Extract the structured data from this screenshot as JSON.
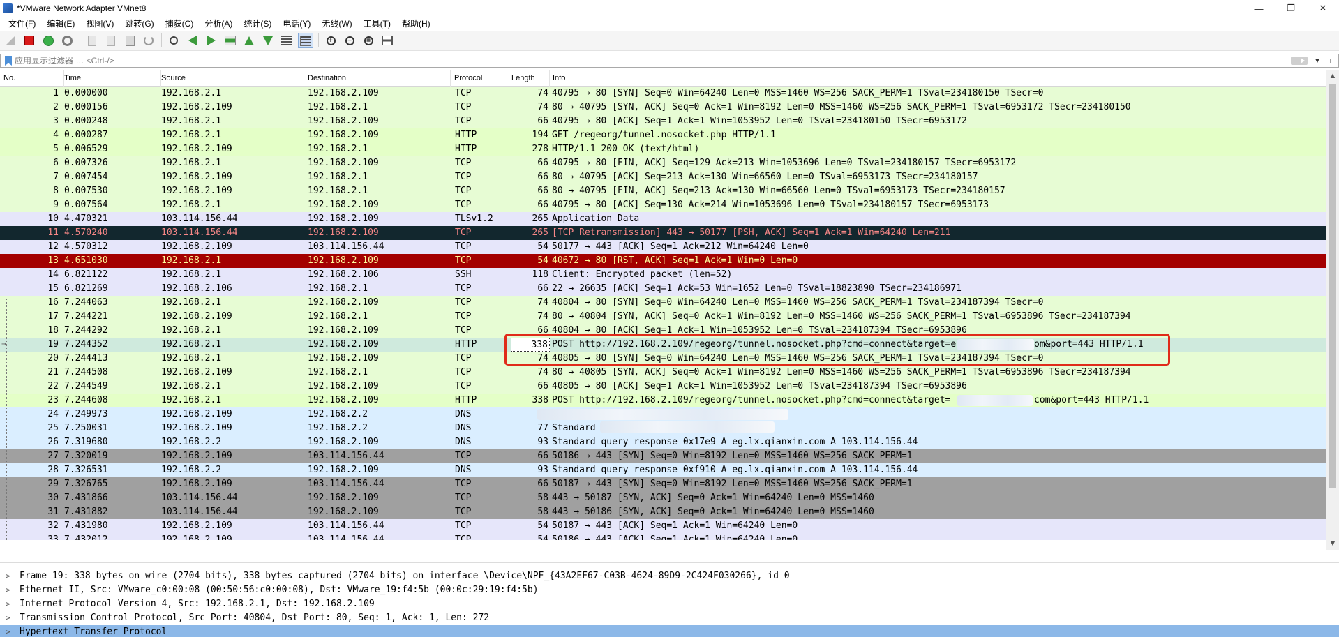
{
  "window": {
    "title": "*VMware Network Adapter VMnet8",
    "controls": [
      "—",
      "❐",
      "✕"
    ]
  },
  "menu": [
    "文件(F)",
    "编辑(E)",
    "视图(V)",
    "跳转(G)",
    "捕获(C)",
    "分析(A)",
    "统计(S)",
    "电话(Y)",
    "无线(W)",
    "工具(T)",
    "帮助(H)"
  ],
  "toolbar": {
    "icons": [
      "shark-fin-icon",
      "stop-capture-icon",
      "restart-capture-icon",
      "capture-options-gear-icon",
      "open-file-icon",
      "save-file-icon",
      "close-file-icon",
      "reload-file-icon",
      "find-packet-icon",
      "go-back-icon",
      "go-forward-icon",
      "go-to-packet-icon",
      "first-packet-icon",
      "last-packet-icon",
      "auto-scroll-icon",
      "colorize-icon",
      "zoom-in-icon",
      "zoom-out-icon",
      "zoom-normal-icon",
      "resize-columns-icon"
    ]
  },
  "filter": {
    "placeholder": "应用显示过滤器 … <Ctrl-/>",
    "value": ""
  },
  "columns": [
    "No.",
    "Time",
    "Source",
    "Destination",
    "Protocol",
    "Length",
    "Info"
  ],
  "row_colors": {
    "tcp": "#e7fcd4",
    "http": "#e4ffc7",
    "tls": "#e6e6fa",
    "ssh": "#e6e6fa",
    "dns": "#daeeff",
    "retrans": "#12272e",
    "rst": "#a40000",
    "syn_gray": "#a0a0a0",
    "selected": "#cfeadd"
  },
  "packets": [
    {
      "no": "1",
      "time": "0.000000",
      "src": "192.168.2.1",
      "dst": "192.168.2.109",
      "proto": "TCP",
      "len": "74",
      "info": "40795 → 80 [SYN] Seq=0 Win=64240 Len=0 MSS=1460 WS=256 SACK_PERM=1 TSval=234180150 TSecr=0",
      "style": "tcp"
    },
    {
      "no": "2",
      "time": "0.000156",
      "src": "192.168.2.109",
      "dst": "192.168.2.1",
      "proto": "TCP",
      "len": "74",
      "info": "80 → 40795 [SYN, ACK] Seq=0 Ack=1 Win=8192 Len=0 MSS=1460 WS=256 SACK_PERM=1 TSval=6953172 TSecr=234180150",
      "style": "tcp"
    },
    {
      "no": "3",
      "time": "0.000248",
      "src": "192.168.2.1",
      "dst": "192.168.2.109",
      "proto": "TCP",
      "len": "66",
      "info": "40795 → 80 [ACK] Seq=1 Ack=1 Win=1053952 Len=0 TSval=234180150 TSecr=6953172",
      "style": "tcp"
    },
    {
      "no": "4",
      "time": "0.000287",
      "src": "192.168.2.1",
      "dst": "192.168.2.109",
      "proto": "HTTP",
      "len": "194",
      "info": "GET /regeorg/tunnel.nosocket.php HTTP/1.1",
      "style": "http"
    },
    {
      "no": "5",
      "time": "0.006529",
      "src": "192.168.2.109",
      "dst": "192.168.2.1",
      "proto": "HTTP",
      "len": "278",
      "info": "HTTP/1.1 200 OK  (text/html)",
      "style": "http"
    },
    {
      "no": "6",
      "time": "0.007326",
      "src": "192.168.2.1",
      "dst": "192.168.2.109",
      "proto": "TCP",
      "len": "66",
      "info": "40795 → 80 [FIN, ACK] Seq=129 Ack=213 Win=1053696 Len=0 TSval=234180157 TSecr=6953172",
      "style": "tcp"
    },
    {
      "no": "7",
      "time": "0.007454",
      "src": "192.168.2.109",
      "dst": "192.168.2.1",
      "proto": "TCP",
      "len": "66",
      "info": "80 → 40795 [ACK] Seq=213 Ack=130 Win=66560 Len=0 TSval=6953173 TSecr=234180157",
      "style": "tcp"
    },
    {
      "no": "8",
      "time": "0.007530",
      "src": "192.168.2.109",
      "dst": "192.168.2.1",
      "proto": "TCP",
      "len": "66",
      "info": "80 → 40795 [FIN, ACK] Seq=213 Ack=130 Win=66560 Len=0 TSval=6953173 TSecr=234180157",
      "style": "tcp"
    },
    {
      "no": "9",
      "time": "0.007564",
      "src": "192.168.2.1",
      "dst": "192.168.2.109",
      "proto": "TCP",
      "len": "66",
      "info": "40795 → 80 [ACK] Seq=130 Ack=214 Win=1053696 Len=0 TSval=234180157 TSecr=6953173",
      "style": "tcp"
    },
    {
      "no": "10",
      "time": "4.470321",
      "src": "103.114.156.44",
      "dst": "192.168.2.109",
      "proto": "TLSv1.2",
      "len": "265",
      "info": "Application Data",
      "style": "tls"
    },
    {
      "no": "11",
      "time": "4.570240",
      "src": "103.114.156.44",
      "dst": "192.168.2.109",
      "proto": "TCP",
      "len": "265",
      "info": "[TCP Retransmission] 443 → 50177 [PSH, ACK] Seq=1 Ack=1 Win=64240 Len=211",
      "style": "retrans"
    },
    {
      "no": "12",
      "time": "4.570312",
      "src": "192.168.2.109",
      "dst": "103.114.156.44",
      "proto": "TCP",
      "len": "54",
      "info": "50177 → 443 [ACK] Seq=1 Ack=212 Win=64240 Len=0",
      "style": "tls"
    },
    {
      "no": "13",
      "time": "4.651030",
      "src": "192.168.2.1",
      "dst": "192.168.2.109",
      "proto": "TCP",
      "len": "54",
      "info": "40672 → 80 [RST, ACK] Seq=1 Ack=1 Win=0 Len=0",
      "style": "rst"
    },
    {
      "no": "14",
      "time": "6.821122",
      "src": "192.168.2.1",
      "dst": "192.168.2.106",
      "proto": "SSH",
      "len": "118",
      "info": "Client: Encrypted packet (len=52)",
      "style": "ssh"
    },
    {
      "no": "15",
      "time": "6.821269",
      "src": "192.168.2.106",
      "dst": "192.168.2.1",
      "proto": "TCP",
      "len": "66",
      "info": "22 → 26635 [ACK] Seq=1 Ack=53 Win=1652 Len=0 TSval=18823890 TSecr=234186971",
      "style": "tls"
    },
    {
      "no": "16",
      "time": "7.244063",
      "src": "192.168.2.1",
      "dst": "192.168.2.109",
      "proto": "TCP",
      "len": "74",
      "info": "40804 → 80 [SYN] Seq=0 Win=64240 Len=0 MSS=1460 WS=256 SACK_PERM=1 TSval=234187394 TSecr=0",
      "style": "tcp"
    },
    {
      "no": "17",
      "time": "7.244221",
      "src": "192.168.2.109",
      "dst": "192.168.2.1",
      "proto": "TCP",
      "len": "74",
      "info": "80 → 40804 [SYN, ACK] Seq=0 Ack=1 Win=8192 Len=0 MSS=1460 WS=256 SACK_PERM=1 TSval=6953896 TSecr=234187394",
      "style": "tcp"
    },
    {
      "no": "18",
      "time": "7.244292",
      "src": "192.168.2.1",
      "dst": "192.168.2.109",
      "proto": "TCP",
      "len": "66",
      "info": "40804 → 80 [ACK] Seq=1 Ack=1 Win=1053952 Len=0 TSval=234187394 TSecr=6953896",
      "style": "tcp"
    },
    {
      "no": "19",
      "time": "7.244352",
      "src": "192.168.2.1",
      "dst": "192.168.2.109",
      "proto": "HTTP",
      "len": "338",
      "info": "POST http://192.168.2.109/regeorg/tunnel.nosocket.php?cmd=connect&target=e",
      "info_tail": "om&port=443 HTTP/1.1",
      "style": "selected"
    },
    {
      "no": "20",
      "time": "7.244413",
      "src": "192.168.2.1",
      "dst": "192.168.2.109",
      "proto": "TCP",
      "len": "74",
      "info": "40805 → 80 [SYN] Seq=0 Win=64240 Len=0 MSS=1460 WS=256 SACK_PERM=1 TSval=234187394 TSecr=0",
      "style": "tcp"
    },
    {
      "no": "21",
      "time": "7.244508",
      "src": "192.168.2.109",
      "dst": "192.168.2.1",
      "proto": "TCP",
      "len": "74",
      "info": "80 → 40805 [SYN, ACK] Seq=0 Ack=1 Win=8192 Len=0 MSS=1460 WS=256 SACK_PERM=1 TSval=6953896 TSecr=234187394",
      "style": "tcp"
    },
    {
      "no": "22",
      "time": "7.244549",
      "src": "192.168.2.1",
      "dst": "192.168.2.109",
      "proto": "TCP",
      "len": "66",
      "info": "40805 → 80 [ACK] Seq=1 Ack=1 Win=1053952 Len=0 TSval=234187394 TSecr=6953896",
      "style": "tcp"
    },
    {
      "no": "23",
      "time": "7.244608",
      "src": "192.168.2.1",
      "dst": "192.168.2.109",
      "proto": "HTTP",
      "len": "338",
      "info": "POST http://192.168.2.109/regeorg/tunnel.nosocket.php?cmd=connect&target=",
      "info_tail": "com&port=443 HTTP/1.1",
      "style": "http"
    },
    {
      "no": "24",
      "time": "7.249973",
      "src": "192.168.2.109",
      "dst": "192.168.2.2",
      "proto": "DNS",
      "len": "",
      "info": "",
      "style": "dns"
    },
    {
      "no": "25",
      "time": "7.250031",
      "src": "192.168.2.109",
      "dst": "192.168.2.2",
      "proto": "DNS",
      "len": "77",
      "info": "Standard",
      "style": "dns"
    },
    {
      "no": "26",
      "time": "7.319680",
      "src": "192.168.2.2",
      "dst": "192.168.2.109",
      "proto": "DNS",
      "len": "93",
      "info": "Standard query response 0x17e9 A eg.lx.qianxin.com A 103.114.156.44",
      "style": "dns"
    },
    {
      "no": "27",
      "time": "7.320019",
      "src": "192.168.2.109",
      "dst": "103.114.156.44",
      "proto": "TCP",
      "len": "66",
      "info": "50186 → 443 [SYN] Seq=0 Win=8192 Len=0 MSS=1460 WS=256 SACK_PERM=1",
      "style": "syn_gray"
    },
    {
      "no": "28",
      "time": "7.326531",
      "src": "192.168.2.2",
      "dst": "192.168.2.109",
      "proto": "DNS",
      "len": "93",
      "info": "Standard query response 0xf910 A eg.lx.qianxin.com A 103.114.156.44",
      "style": "dns"
    },
    {
      "no": "29",
      "time": "7.326765",
      "src": "192.168.2.109",
      "dst": "103.114.156.44",
      "proto": "TCP",
      "len": "66",
      "info": "50187 → 443 [SYN] Seq=0 Win=8192 Len=0 MSS=1460 WS=256 SACK_PERM=1",
      "style": "syn_gray"
    },
    {
      "no": "30",
      "time": "7.431866",
      "src": "103.114.156.44",
      "dst": "192.168.2.109",
      "proto": "TCP",
      "len": "58",
      "info": "443 → 50187 [SYN, ACK] Seq=0 Ack=1 Win=64240 Len=0 MSS=1460",
      "style": "syn_gray"
    },
    {
      "no": "31",
      "time": "7.431882",
      "src": "103.114.156.44",
      "dst": "192.168.2.109",
      "proto": "TCP",
      "len": "58",
      "info": "443 → 50186 [SYN, ACK] Seq=0 Ack=1 Win=64240 Len=0 MSS=1460",
      "style": "syn_gray"
    },
    {
      "no": "32",
      "time": "7.431980",
      "src": "192.168.2.109",
      "dst": "103.114.156.44",
      "proto": "TCP",
      "len": "54",
      "info": "50187 → 443 [ACK] Seq=1 Ack=1 Win=64240 Len=0",
      "style": "tls"
    },
    {
      "no": "33",
      "time": "7.432012",
      "src": "192.168.2.109",
      "dst": "103.114.156.44",
      "proto": "TCP",
      "len": "54",
      "info": "50186 → 443 [ACK] Seq=1 Ack=1 Win=64240 Len=0",
      "style": "tls"
    }
  ],
  "details": [
    "Frame 19: 338 bytes on wire (2704 bits), 338 bytes captured (2704 bits) on interface \\Device\\NPF_{43A2EF67-C03B-4624-89D9-2C424F030266}, id 0",
    "Ethernet II, Src: VMware_c0:00:08 (00:50:56:c0:00:08), Dst: VMware_19:f4:5b (00:0c:29:19:f4:5b)",
    "Internet Protocol Version 4, Src: 192.168.2.1, Dst: 192.168.2.109",
    "Transmission Control Protocol, Src Port: 40804, Dst Port: 80, Seq: 1, Ack: 1, Len: 272",
    "Hypertext Transfer Protocol"
  ],
  "highlight_color": "#e02b1a"
}
